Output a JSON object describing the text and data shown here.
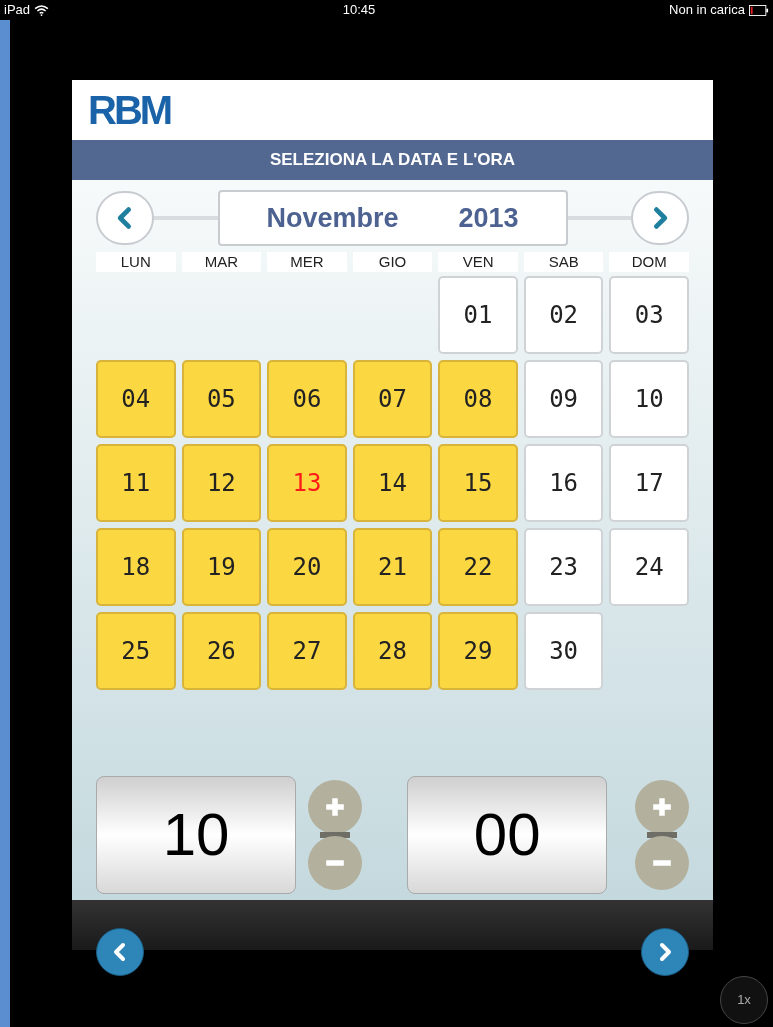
{
  "status_bar": {
    "device": "iPad",
    "time": "10:45",
    "battery_text": "Non in carica"
  },
  "logo": {
    "text": "RBM"
  },
  "header": {
    "title": "SELEZIONA LA DATA E L'ORA"
  },
  "calendar": {
    "month": "Novembre",
    "year": "2013",
    "weekdays": [
      "LUN",
      "MAR",
      "MER",
      "GIO",
      "VEN",
      "SAB",
      "DOM"
    ],
    "weeks": [
      [
        {
          "kind": "blank"
        },
        {
          "kind": "blank"
        },
        {
          "kind": "blank"
        },
        {
          "kind": "blank"
        },
        {
          "kind": "day",
          "label": "01",
          "available": false,
          "today": false
        },
        {
          "kind": "day",
          "label": "02",
          "available": false,
          "today": false
        },
        {
          "kind": "day",
          "label": "03",
          "available": false,
          "today": false
        }
      ],
      [
        {
          "kind": "day",
          "label": "04",
          "available": true,
          "today": false
        },
        {
          "kind": "day",
          "label": "05",
          "available": true,
          "today": false
        },
        {
          "kind": "day",
          "label": "06",
          "available": true,
          "today": false
        },
        {
          "kind": "day",
          "label": "07",
          "available": true,
          "today": false
        },
        {
          "kind": "day",
          "label": "08",
          "available": true,
          "today": false
        },
        {
          "kind": "day",
          "label": "09",
          "available": false,
          "today": false
        },
        {
          "kind": "day",
          "label": "10",
          "available": false,
          "today": false
        }
      ],
      [
        {
          "kind": "day",
          "label": "11",
          "available": true,
          "today": false
        },
        {
          "kind": "day",
          "label": "12",
          "available": true,
          "today": false
        },
        {
          "kind": "day",
          "label": "13",
          "available": true,
          "today": true
        },
        {
          "kind": "day",
          "label": "14",
          "available": true,
          "today": false
        },
        {
          "kind": "day",
          "label": "15",
          "available": true,
          "today": false
        },
        {
          "kind": "day",
          "label": "16",
          "available": false,
          "today": false
        },
        {
          "kind": "day",
          "label": "17",
          "available": false,
          "today": false
        }
      ],
      [
        {
          "kind": "day",
          "label": "18",
          "available": true,
          "today": false
        },
        {
          "kind": "day",
          "label": "19",
          "available": true,
          "today": false
        },
        {
          "kind": "day",
          "label": "20",
          "available": true,
          "today": false
        },
        {
          "kind": "day",
          "label": "21",
          "available": true,
          "today": false
        },
        {
          "kind": "day",
          "label": "22",
          "available": true,
          "today": false
        },
        {
          "kind": "day",
          "label": "23",
          "available": false,
          "today": false
        },
        {
          "kind": "day",
          "label": "24",
          "available": false,
          "today": false
        }
      ],
      [
        {
          "kind": "day",
          "label": "25",
          "available": true,
          "today": false
        },
        {
          "kind": "day",
          "label": "26",
          "available": true,
          "today": false
        },
        {
          "kind": "day",
          "label": "27",
          "available": true,
          "today": false
        },
        {
          "kind": "day",
          "label": "28",
          "available": true,
          "today": false
        },
        {
          "kind": "day",
          "label": "29",
          "available": true,
          "today": false
        },
        {
          "kind": "day",
          "label": "30",
          "available": false,
          "today": false
        },
        {
          "kind": "blank"
        }
      ]
    ]
  },
  "time": {
    "hour": "10",
    "minute": "00"
  },
  "zoom_badge": "1x"
}
